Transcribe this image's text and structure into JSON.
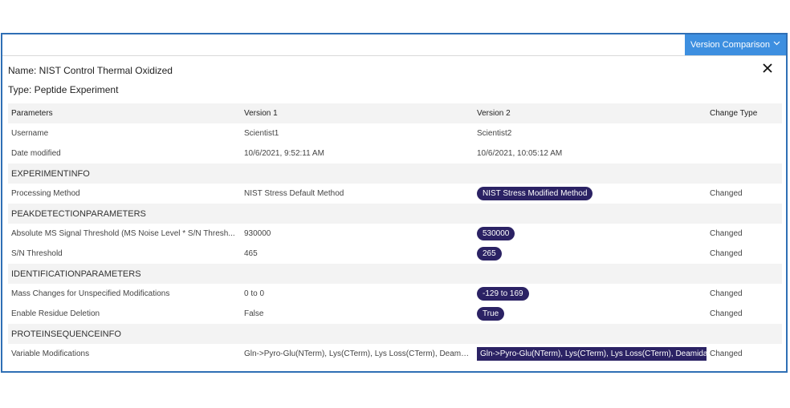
{
  "toolbar": {
    "version_comparison_label": "Version Comparison"
  },
  "header": {
    "name": "Name: NIST Control Thermal Oxidized",
    "type": "Type: Peptide Experiment"
  },
  "table": {
    "columns": [
      "Parameters",
      "Version 1",
      "Version 2",
      "Change Type"
    ],
    "rows": [
      {
        "kind": "row",
        "param": "Username",
        "v1": "Scientist1",
        "v2": "Scientist2",
        "highlight": false,
        "change": ""
      },
      {
        "kind": "row",
        "param": "Date modified",
        "v1": "10/6/2021, 9:52:11 AM",
        "v2": "10/6/2021, 10:05:12 AM",
        "highlight": false,
        "change": ""
      },
      {
        "kind": "section",
        "label": "EXPERIMENTINFO"
      },
      {
        "kind": "row",
        "param": "Processing Method",
        "v1": "NIST Stress Default Method",
        "v2": "NIST Stress Modified Method",
        "highlight": true,
        "change": "Changed"
      },
      {
        "kind": "section",
        "label": "PEAKDETECTIONPARAMETERS"
      },
      {
        "kind": "row",
        "param": "Absolute MS Signal Threshold (MS Noise Level * S/N Thresh...",
        "v1": "930000",
        "v2": "530000",
        "highlight": true,
        "change": "Changed"
      },
      {
        "kind": "row",
        "param": "S/N Threshold",
        "v1": "465",
        "v2": "265",
        "highlight": true,
        "change": "Changed"
      },
      {
        "kind": "section",
        "label": "IDENTIFICATIONPARAMETERS"
      },
      {
        "kind": "row",
        "param": "Mass Changes for Unspecified Modifications",
        "v1": "0 to 0",
        "v2": "-129 to 169",
        "highlight": true,
        "change": "Changed"
      },
      {
        "kind": "row",
        "param": "Enable Residue Deletion",
        "v1": "False",
        "v2": "True",
        "highlight": true,
        "change": "Changed"
      },
      {
        "kind": "section",
        "label": "PROTEINSEQUENCEINFO"
      },
      {
        "kind": "row",
        "param": "Variable Modifications",
        "v1": "Gln->Pyro-Glu(NTerm), Lys(CTerm), Lys Loss(CTerm), Deamid...",
        "v2": "Gln->Pyro-Glu(NTerm), Lys(CTerm), Lys Loss(CTerm), Deamidat",
        "highlight": true,
        "long": true,
        "change": "Changed"
      }
    ]
  },
  "colors": {
    "accent": "#3d8fe0",
    "frame": "#2f6fb5",
    "badge": "#2b2264",
    "section_bg": "#f3f3f3"
  },
  "icons": {
    "close": "close-icon",
    "dropdown": "chevron-down-icon"
  }
}
